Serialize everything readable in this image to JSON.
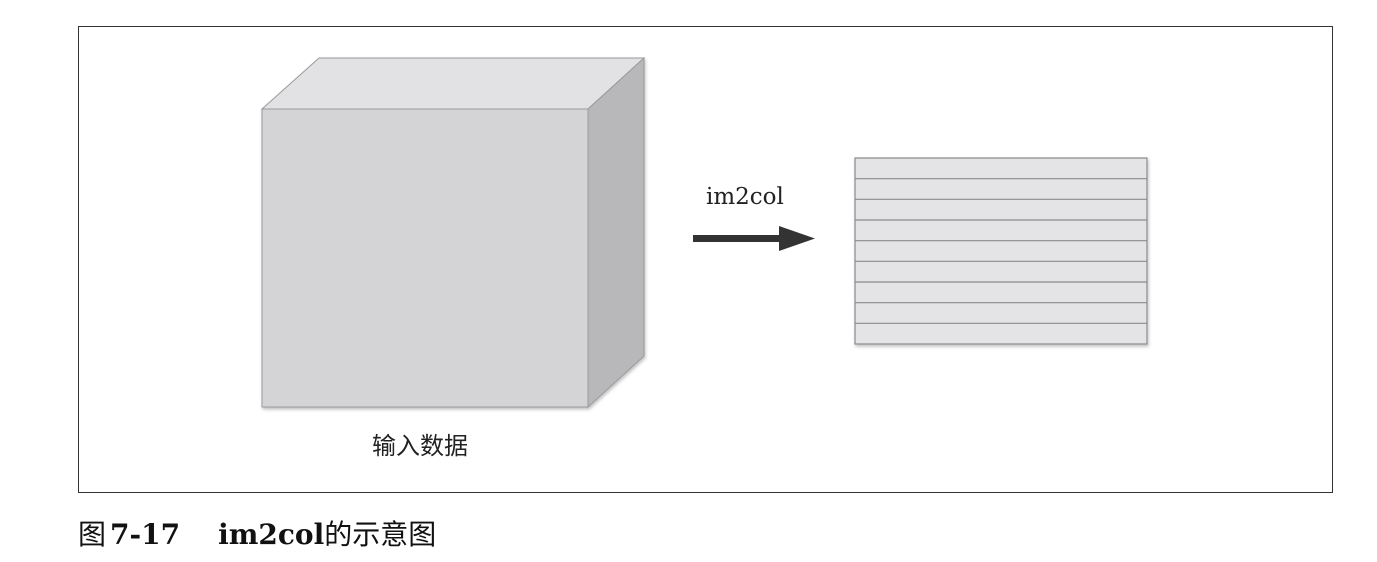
{
  "diagram": {
    "input_label": "输入数据",
    "operation_label": "im2col",
    "matrix_rows": 9
  },
  "caption": {
    "prefix": "图",
    "number": "7-17",
    "title_en": "im2col",
    "title_zh": "的示意图"
  },
  "colors": {
    "cube_front": "#d4d4d6",
    "cube_top": "#e2e2e4",
    "cube_side": "#b8b8bb",
    "matrix_fill": "#e4e4e6",
    "matrix_line": "#8a8a8c",
    "arrow": "#333333",
    "frame": "#333333"
  }
}
